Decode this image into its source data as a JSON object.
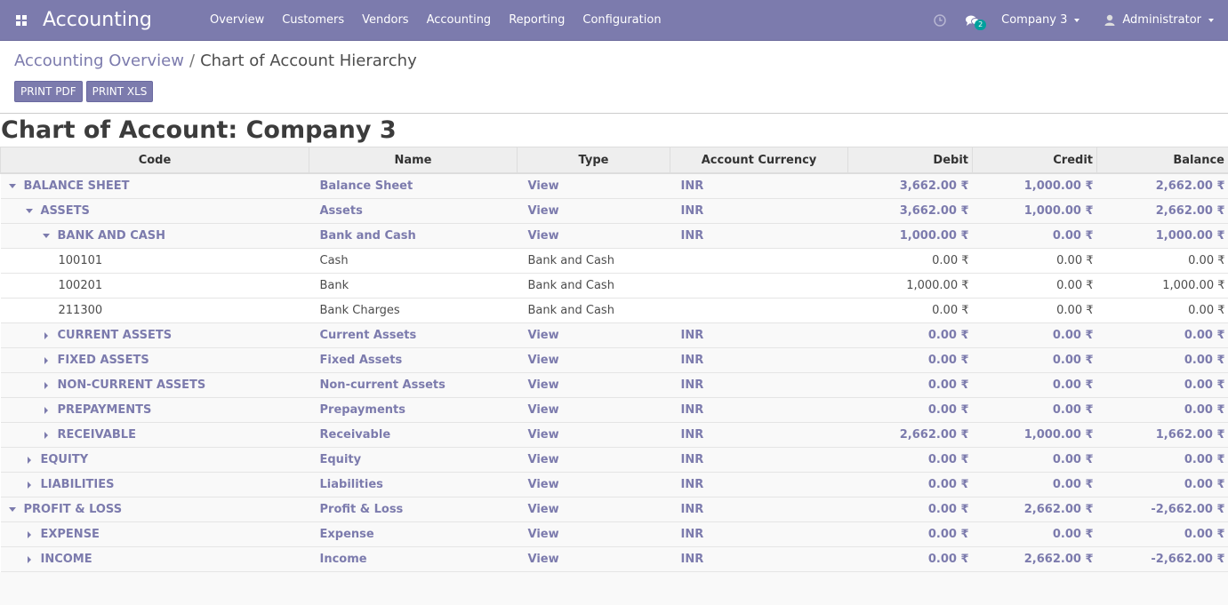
{
  "navbar": {
    "app_title": "Accounting",
    "menu": [
      "Overview",
      "Customers",
      "Vendors",
      "Accounting",
      "Reporting",
      "Configuration"
    ],
    "chat_count": "2",
    "company": "Company 3",
    "user": "Administrator"
  },
  "breadcrumb": {
    "parent": "Accounting Overview",
    "separator": "/",
    "current": "Chart of Account Hierarchy"
  },
  "buttons": {
    "print_pdf": "PRINT PDF",
    "print_xls": "PRINT XLS"
  },
  "report": {
    "title": "Chart of Account: Company 3",
    "columns": [
      "Code",
      "Name",
      "Type",
      "Account Currency",
      "Debit",
      "Credit",
      "Balance"
    ],
    "rows": [
      {
        "level": 0,
        "kind": "group",
        "expanded": true,
        "code": "BALANCE SHEET",
        "name": "Balance Sheet",
        "type": "View",
        "currency": "INR",
        "debit": "3,662.00 ₹",
        "credit": "1,000.00 ₹",
        "balance": "2,662.00 ₹"
      },
      {
        "level": 1,
        "kind": "group",
        "expanded": true,
        "code": "ASSETS",
        "name": "Assets",
        "type": "View",
        "currency": "INR",
        "debit": "3,662.00 ₹",
        "credit": "1,000.00 ₹",
        "balance": "2,662.00 ₹"
      },
      {
        "level": 2,
        "kind": "group",
        "expanded": true,
        "code": "BANK AND CASH",
        "name": "Bank and Cash",
        "type": "View",
        "currency": "INR",
        "debit": "1,000.00 ₹",
        "credit": "0.00 ₹",
        "balance": "1,000.00 ₹"
      },
      {
        "level": 3,
        "kind": "leaf",
        "code": "100101",
        "name": "Cash",
        "type": "Bank and Cash",
        "currency": "",
        "debit": "0.00 ₹",
        "credit": "0.00 ₹",
        "balance": "0.00 ₹"
      },
      {
        "level": 3,
        "kind": "leaf",
        "code": "100201",
        "name": "Bank",
        "type": "Bank and Cash",
        "currency": "",
        "debit": "1,000.00 ₹",
        "credit": "0.00 ₹",
        "balance": "1,000.00 ₹"
      },
      {
        "level": 3,
        "kind": "leaf",
        "code": "211300",
        "name": "Bank Charges",
        "type": "Bank and Cash",
        "currency": "",
        "debit": "0.00 ₹",
        "credit": "0.00 ₹",
        "balance": "0.00 ₹"
      },
      {
        "level": 2,
        "kind": "group",
        "expanded": false,
        "code": "CURRENT ASSETS",
        "name": "Current Assets",
        "type": "View",
        "currency": "INR",
        "debit": "0.00 ₹",
        "credit": "0.00 ₹",
        "balance": "0.00 ₹"
      },
      {
        "level": 2,
        "kind": "group",
        "expanded": false,
        "code": "FIXED ASSETS",
        "name": "Fixed Assets",
        "type": "View",
        "currency": "INR",
        "debit": "0.00 ₹",
        "credit": "0.00 ₹",
        "balance": "0.00 ₹"
      },
      {
        "level": 2,
        "kind": "group",
        "expanded": false,
        "code": "NON-CURRENT ASSETS",
        "name": "Non-current Assets",
        "type": "View",
        "currency": "INR",
        "debit": "0.00 ₹",
        "credit": "0.00 ₹",
        "balance": "0.00 ₹"
      },
      {
        "level": 2,
        "kind": "group",
        "expanded": false,
        "code": "PREPAYMENTS",
        "name": "Prepayments",
        "type": "View",
        "currency": "INR",
        "debit": "0.00 ₹",
        "credit": "0.00 ₹",
        "balance": "0.00 ₹"
      },
      {
        "level": 2,
        "kind": "group",
        "expanded": false,
        "code": "RECEIVABLE",
        "name": "Receivable",
        "type": "View",
        "currency": "INR",
        "debit": "2,662.00 ₹",
        "credit": "1,000.00 ₹",
        "balance": "1,662.00 ₹"
      },
      {
        "level": 1,
        "kind": "group",
        "expanded": false,
        "code": "EQUITY",
        "name": "Equity",
        "type": "View",
        "currency": "INR",
        "debit": "0.00 ₹",
        "credit": "0.00 ₹",
        "balance": "0.00 ₹"
      },
      {
        "level": 1,
        "kind": "group",
        "expanded": false,
        "code": "LIABILITIES",
        "name": "Liabilities",
        "type": "View",
        "currency": "INR",
        "debit": "0.00 ₹",
        "credit": "0.00 ₹",
        "balance": "0.00 ₹"
      },
      {
        "level": 0,
        "kind": "group",
        "expanded": true,
        "code": "PROFIT & LOSS",
        "name": "Profit & Loss",
        "type": "View",
        "currency": "INR",
        "debit": "0.00 ₹",
        "credit": "2,662.00 ₹",
        "balance": "-2,662.00 ₹"
      },
      {
        "level": 1,
        "kind": "group",
        "expanded": false,
        "code": "EXPENSE",
        "name": "Expense",
        "type": "View",
        "currency": "INR",
        "debit": "0.00 ₹",
        "credit": "0.00 ₹",
        "balance": "0.00 ₹"
      },
      {
        "level": 1,
        "kind": "group",
        "expanded": false,
        "code": "INCOME",
        "name": "Income",
        "type": "View",
        "currency": "INR",
        "debit": "0.00 ₹",
        "credit": "2,662.00 ₹",
        "balance": "-2,662.00 ₹"
      }
    ]
  },
  "colors": {
    "brand": "#7c7bad",
    "badge": "#00a09d"
  },
  "icons": [
    "apps-grid-icon",
    "clock-icon",
    "chat-icon",
    "caret-down-icon",
    "user-icon",
    "expand-caret-icon",
    "collapse-caret-icon"
  ]
}
